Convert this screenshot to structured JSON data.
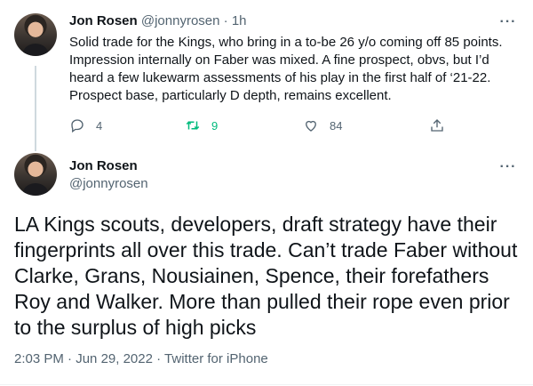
{
  "reply_tweet": {
    "display_name": "Jon Rosen",
    "handle": "@jonnyrosen",
    "separator": "·",
    "time": "1h",
    "text": "Solid trade for the Kings, who bring in a to-be 26 y/o coming off 85 points. Impression internally on Faber was mixed. A fine prospect, obvs, but I’d heard a few lukewarm assessments of his play in the first half of ‘21-22. Prospect base, particularly D depth, remains excellent.",
    "replies": "4",
    "retweets": "9",
    "likes": "84",
    "icons": [
      "reply-icon",
      "retweet-icon",
      "like-icon",
      "share-icon",
      "more-icon"
    ],
    "retweet_color": "#00ba7c"
  },
  "main_tweet": {
    "display_name": "Jon Rosen",
    "handle": "@jonnyrosen",
    "text": "LA Kings scouts, developers, draft strategy have their fingerprints all over this trade. Can’t trade Faber without Clarke, Grans, Nousiainen, Spence, their forefathers Roy and Walker. More than pulled their rope even prior to the surplus of high picks",
    "time": "2:03 PM",
    "dot1": "·",
    "date": "Jun 29, 2022",
    "dot2": "·",
    "source": "Twitter for iPhone"
  }
}
